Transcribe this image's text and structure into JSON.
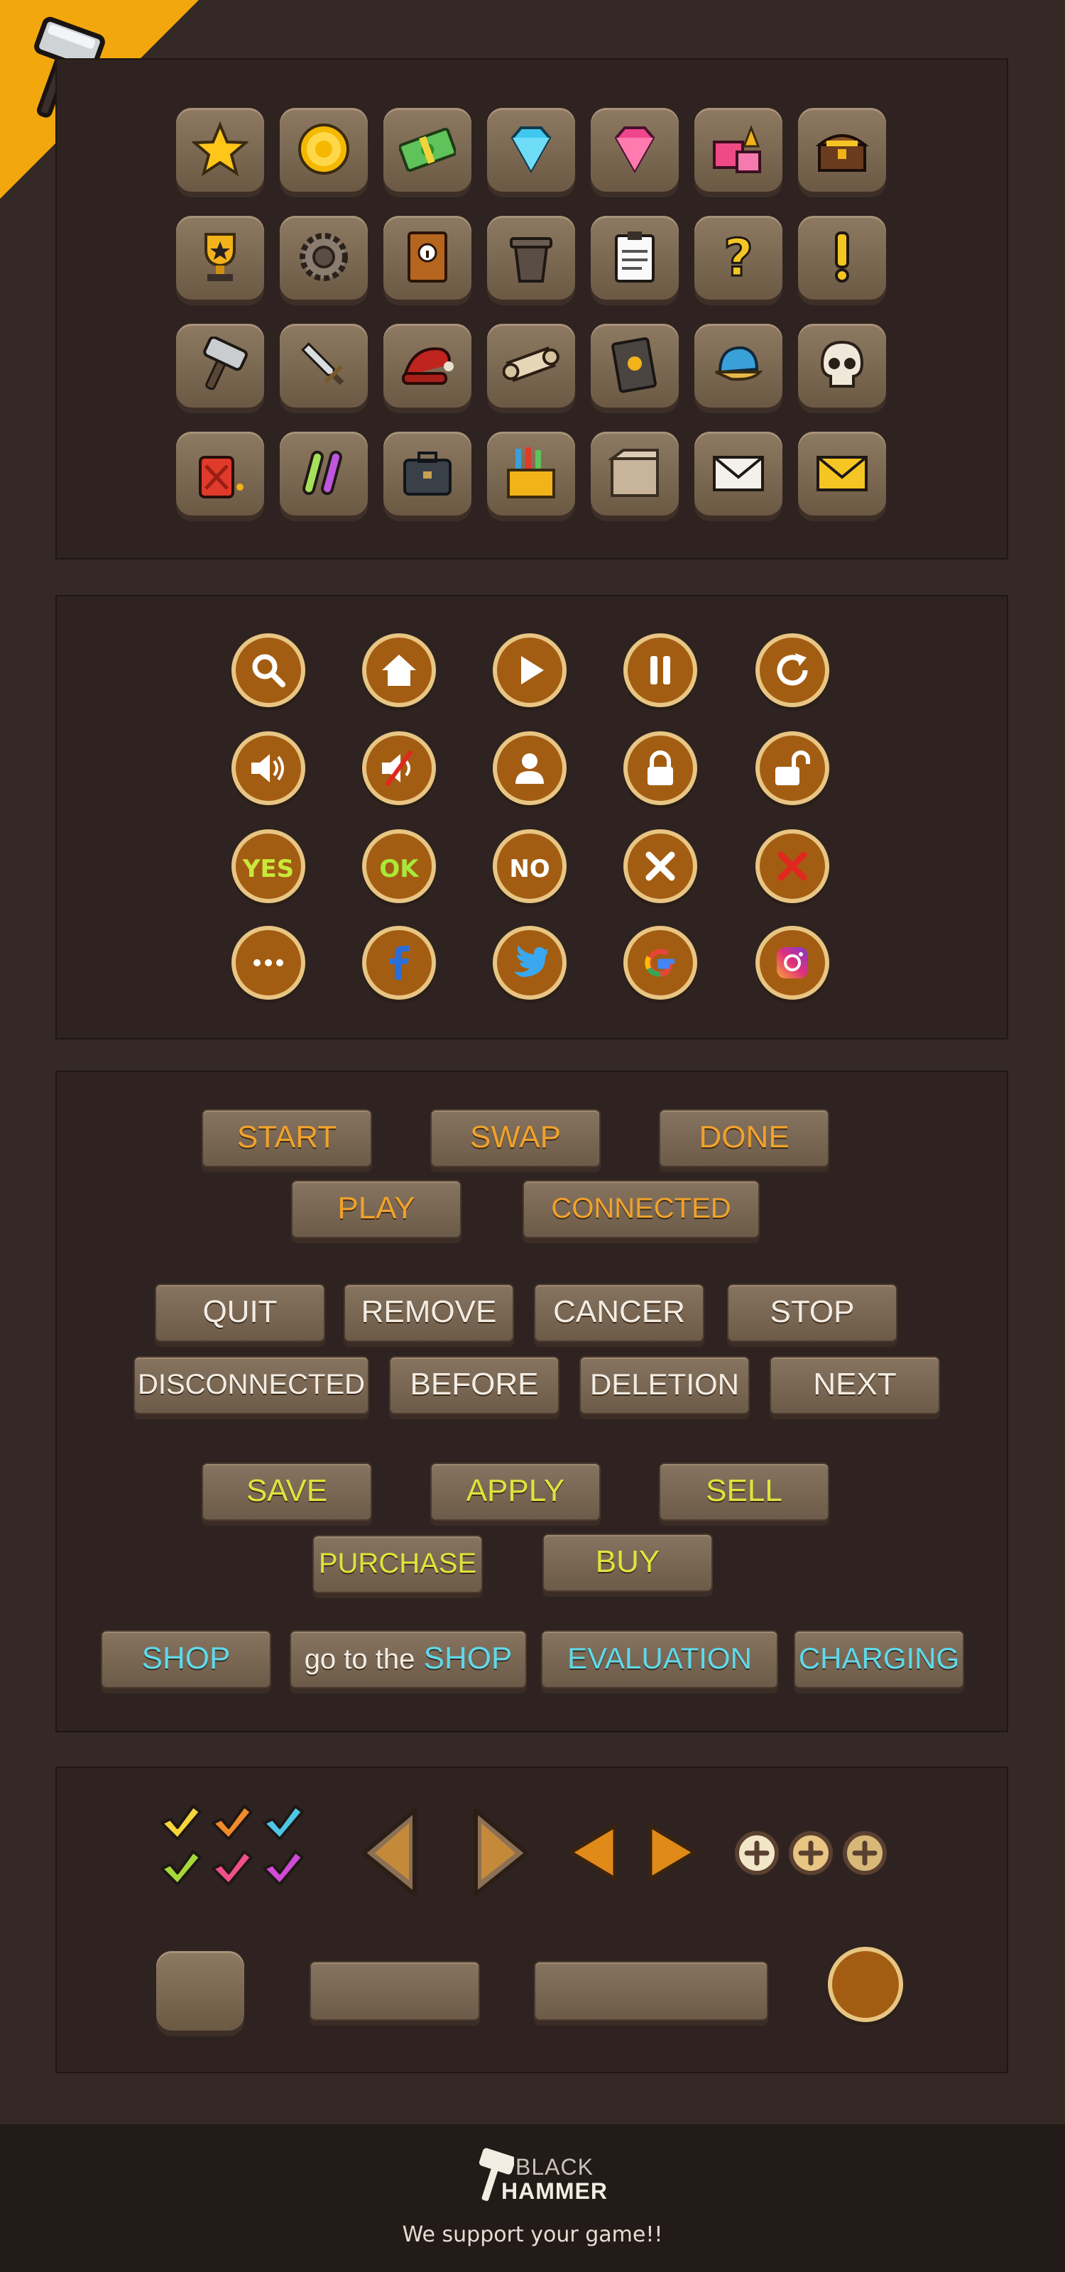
{
  "corner_badge": {
    "icon": "hammer-icon",
    "color": "#f2a80d"
  },
  "icon_tiles": [
    "star-icon",
    "coin-icon",
    "cash-icon",
    "blue-diamond-icon",
    "pink-diamond-icon",
    "gift-boxes-icon",
    "treasure-chest-icon",
    "trophy-icon",
    "gear-icon",
    "info-book-icon",
    "trash-can-icon",
    "clipboard-icon",
    "question-mark-icon",
    "exclamation-icon",
    "hammer-icon",
    "sword-icon",
    "santa-hat-icon",
    "scroll-icon",
    "spell-book-icon",
    "cap-icon",
    "skull-icon",
    "fuel-can-icon",
    "potion-tubes-icon",
    "briefcase-icon",
    "pencil-box-icon",
    "package-icon",
    "mail-white-icon",
    "mail-yellow-icon"
  ],
  "circle_buttons": {
    "row1": [
      "search-icon",
      "home-icon",
      "play-icon",
      "pause-icon",
      "refresh-icon"
    ],
    "row2": [
      "sound-on-icon",
      "sound-off-icon",
      "user-icon",
      "lock-icon",
      "unlock-icon"
    ],
    "row3": {
      "yes": "YES",
      "ok": "OK",
      "no": "NO"
    },
    "row3_icons": [
      "close-white-icon",
      "close-red-icon"
    ],
    "row4": [
      "more-icon",
      "facebook-icon",
      "twitter-icon",
      "google-icon",
      "instagram-icon"
    ]
  },
  "buttons": {
    "orange": [
      "START",
      "SWAP",
      "DONE",
      "PLAY",
      "CONNECTED"
    ],
    "white": [
      "QUIT",
      "REMOVE",
      "CANCER",
      "STOP",
      "DISCONNECTED",
      "BEFORE",
      "DELETION",
      "NEXT"
    ],
    "yellow": [
      "SAVE",
      "APPLY",
      "SELL",
      "PURCHASE",
      "BUY"
    ],
    "cyan": {
      "shop": "SHOP",
      "goto_prefix": "go to the",
      "goto_shop": "SHOP",
      "evaluation": "EVALUATION",
      "charging": "CHARGING"
    }
  },
  "checkmark_colors": [
    "#f5d63a",
    "#f08a2a",
    "#4ec7e6",
    "#a6d83a",
    "#ef4f8a",
    "#d04ad8"
  ],
  "footer": {
    "brand_line1": "BLACK",
    "brand_line2": "HAMMER",
    "tagline": "We support your game!!"
  }
}
